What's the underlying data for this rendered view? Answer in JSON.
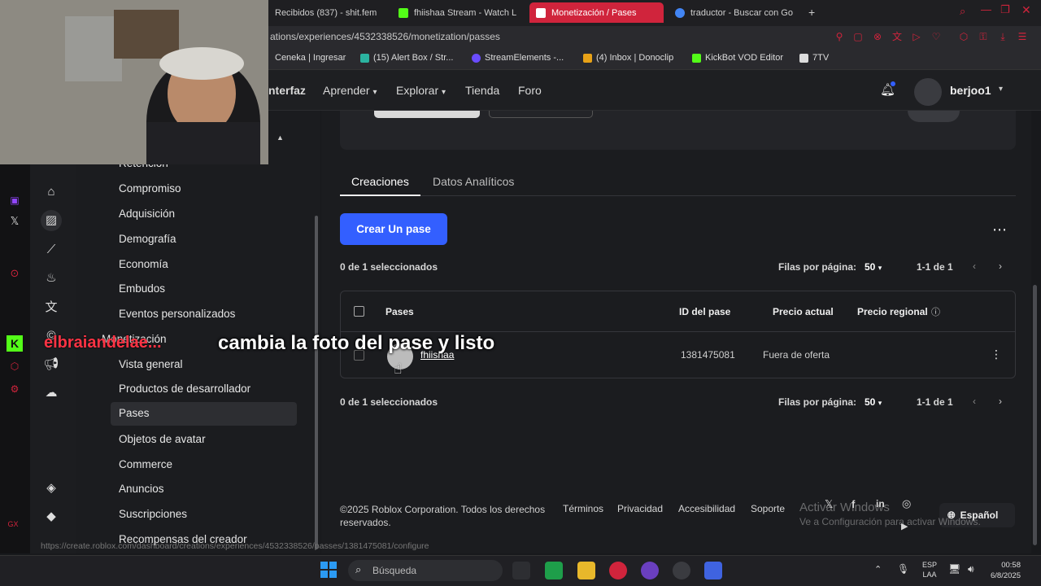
{
  "browser": {
    "tabs": [
      {
        "label": "Recibidos (837) - shit.fem",
        "icon": "gmail-icon"
      },
      {
        "label": "fhiishaa Stream - Watch L",
        "icon": "kick-icon"
      },
      {
        "label": "Monetización / Pases",
        "icon": "roblox-icon",
        "active": true
      },
      {
        "label": "traductor - Buscar con Go",
        "icon": "google-icon"
      }
    ],
    "url": "ations/experiences/4532338526/monetization/passes",
    "bookmarks": [
      "Ceneka | Ingresar",
      "(15) Alert Box / Str...",
      "StreamElements -...",
      "(4) Inbox | Donoclip",
      "KickBot VOD Editor",
      "7TV"
    ]
  },
  "topnav": {
    "items": [
      "nterfaz",
      "Aprender",
      "Explorar",
      "Tienda",
      "Foro"
    ],
    "username": "berjoo1"
  },
  "sidebar": {
    "items": [
      "Retención",
      "Compromiso",
      "Adquisición",
      "Demografía",
      "Economía",
      "Embudos",
      "Eventos personalizados",
      "Monetización",
      "Vista general",
      "Productos de desarrollador",
      "Pases",
      "Objetos de avatar",
      "Commerce",
      "Anuncios",
      "Suscripciones",
      "Recompensas del creador"
    ],
    "selected": "Pases"
  },
  "main": {
    "tabs": [
      "Creaciones",
      "Datos Analíticos"
    ],
    "create_button": "Crear Un pase",
    "selected_count": "0 de 1 seleccionados",
    "rows_per_page_label": "Filas por página:",
    "rows_per_page": "50",
    "range": "1-1 de 1",
    "table": {
      "headers": [
        "Pases",
        "ID del pase",
        "Precio actual",
        "Precio regional"
      ],
      "rows": [
        {
          "name": "fhiishaa",
          "id": "1381475081",
          "price": "Fuera de oferta"
        }
      ]
    }
  },
  "footer": {
    "copyright": "©2025 Roblox Corporation. Todos los derechos reservados.",
    "links": [
      "Términos",
      "Privacidad",
      "Accesibilidad",
      "Soporte"
    ],
    "language": "Español"
  },
  "overlay": {
    "caption": "cambia la foto del pase y listo",
    "chat_name": "elbraiandelae..."
  },
  "status_url": "https://create.roblox.com/dashboard/creations/experiences/4532338526/passes/1381475081/configure",
  "windows": {
    "watermark_title": "Activar Windows",
    "watermark_sub": "Ve a Configuración para activar Windows.",
    "search_placeholder": "Búsqueda",
    "lang_top": "ESP",
    "lang_bottom": "LAA",
    "time": "00:58",
    "date": "6/8/2025"
  },
  "colors": {
    "accent": "#335fff",
    "tab_active": "#d0243c"
  }
}
